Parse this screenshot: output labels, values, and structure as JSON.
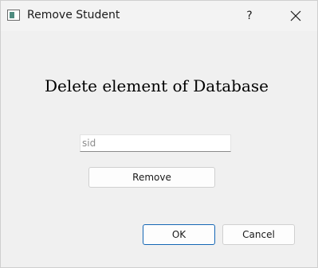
{
  "window": {
    "title": "Remove Student",
    "help_label": "?"
  },
  "icons": {
    "app": "app-window-icon",
    "close": "close-icon"
  },
  "main": {
    "heading": "Delete element of Database",
    "sid_input": {
      "placeholder": "sid",
      "value": ""
    },
    "remove_label": "Remove"
  },
  "footer": {
    "ok_label": "OK",
    "cancel_label": "Cancel"
  },
  "colors": {
    "background": "#f0f0f0",
    "default_button_border": "#1466b4"
  }
}
